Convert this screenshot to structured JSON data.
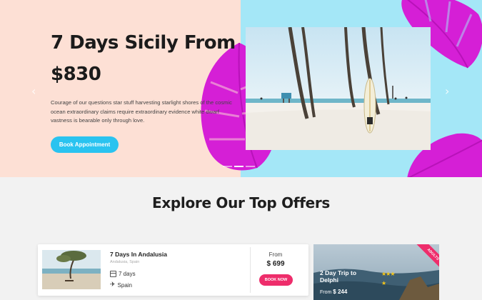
{
  "hero": {
    "title": "7 Days Sicily From $830",
    "description": "Courage of our questions star stuff harvesting starlight shores of the cosmic ocean extraordinary claims require extraordinary evidence white dwarf vastness is bearable only through love.",
    "button_label": "Book Appointment",
    "prev_icon": "chevron-left-icon",
    "next_icon": "chevron-right-icon",
    "slides": 3,
    "active_slide": 2,
    "colors": {
      "left_bg": "#fde0d5",
      "right_bg": "#a4e7f7",
      "leaf": "#d51fd6",
      "button": "#29c3f0"
    }
  },
  "offers": {
    "title": "Explore Our Top Offers",
    "cards": [
      {
        "name": "7 Days In Andalusia",
        "location": "Andalusia, Spain",
        "duration": "7 days",
        "destination": "Spain",
        "from_label": "From",
        "price": "$ 699",
        "button_label": "BOOK NOW",
        "duration_icon": "calendar-icon",
        "destination_icon": "plane-icon"
      },
      {
        "ribbon": "ADULTS ONLY",
        "name": "2 Day Trip to Delphi",
        "stars": "★★★",
        "star_single": "★",
        "from_label": "From",
        "price": "$ 244"
      }
    ],
    "colors": {
      "accent": "#ee2d6b",
      "star": "#f5c518"
    }
  }
}
